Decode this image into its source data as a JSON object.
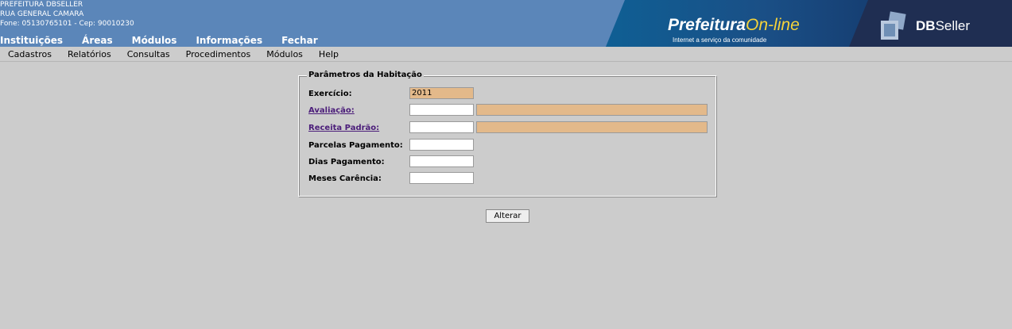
{
  "header": {
    "org_name": "PREFEITURA DBSELLER",
    "street": "RUA GENERAL CAMARA",
    "contact": "Fone: 05130765101  - Cep: 90010230",
    "nav": [
      "Instituições",
      "Áreas",
      "Módulos",
      "Informações",
      "Fechar"
    ],
    "banner_brand": "Prefeitura",
    "banner_brand_suffix": "On-line",
    "banner_tagline": "Internet a serviço da comunidade",
    "company_prefix": "DB",
    "company_suffix": "Seller"
  },
  "menu": [
    "Cadastros",
    "Relatórios",
    "Consultas",
    "Procedimentos",
    "Módulos",
    "Help"
  ],
  "form": {
    "legend": "Parâmetros da Habitação",
    "exercicio_label": "Exercício:",
    "exercicio_value": "2011",
    "avaliacao_label": "Avaliação:",
    "avaliacao_code": "",
    "avaliacao_desc": "",
    "receita_label": "Receita Padrão:",
    "receita_code": "",
    "receita_desc": "",
    "parcelas_label": "Parcelas Pagamento:",
    "parcelas_value": "",
    "dias_label": "Dias Pagamento:",
    "dias_value": "",
    "meses_label": "Meses Carência:",
    "meses_value": "",
    "submit_label": "Alterar"
  },
  "colors": {
    "header_bg": "#5b86b9",
    "readonly_field": "#e3b98a",
    "link_color": "#4b1d7a",
    "page_bg": "#cccccc"
  }
}
